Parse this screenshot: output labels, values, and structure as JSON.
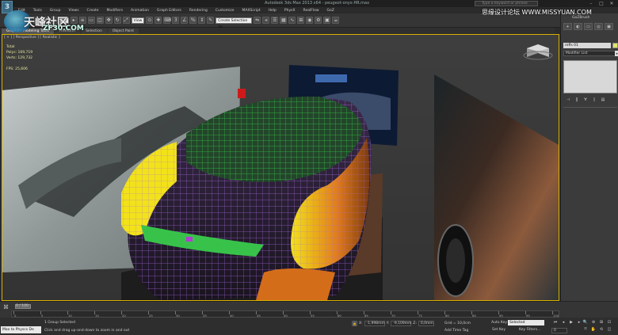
{
  "titlebar": {
    "title": "Autodesk 3ds Max 2013 x64 - peugeot-onyx-HR.max",
    "search_placeholder": "Type a keyword or phrase",
    "minimize": "–",
    "maximize": "□",
    "close": "✕"
  },
  "menu": [
    "Edit",
    "Tools",
    "Group",
    "Views",
    "Create",
    "Modifiers",
    "Animation",
    "Graph Editors",
    "Rendering",
    "Customize",
    "MAXScript",
    "Help",
    "PhysX",
    "RealFlow",
    "GoZ"
  ],
  "toolbar": {
    "selection_filter": "All",
    "view_dropdown": "View",
    "named_selection": "Create Selection Se"
  },
  "ribbon_tabs": [
    {
      "label": "Graphite Modeling Tools",
      "active": true
    },
    {
      "label": "Freeform",
      "active": false
    },
    {
      "label": "Selection",
      "active": false
    },
    {
      "label": "Object Paint",
      "active": false
    }
  ],
  "viewport": {
    "label": "[ + ] [ Perspective ] [ Realistic ]",
    "stats": {
      "total_label": "Total",
      "polys_label": "Polys:",
      "polys_value": "169,719",
      "verts_label": "Verts:",
      "verts_value": "129,732",
      "fps_label": "FPS:",
      "fps_value": "25,606"
    }
  },
  "command_panel": {
    "object_name": "refls 01",
    "modifier_list": "Modifier List",
    "gozbrush": "GoZBrush",
    "tabs": [
      "+",
      "◐",
      "▭",
      "◎",
      "▣",
      "✎"
    ],
    "stack_icons": [
      "⊣",
      "‖",
      "∀",
      "▯",
      "▤"
    ]
  },
  "timeline": {
    "slider_label": "0 / 100",
    "ticks": [
      "0",
      "5",
      "10",
      "15",
      "20",
      "25",
      "30",
      "35",
      "40",
      "45",
      "50",
      "55",
      "60",
      "65",
      "70",
      "75",
      "80",
      "85",
      "90",
      "95",
      "100"
    ]
  },
  "statusbar": {
    "maxscript_text": "Max to Physcs De",
    "selection_status": "1 Group Selected",
    "prompt": "Click and drag up-and-down to zoom in and out",
    "x_label": "X:",
    "x_value": "-1,998mm",
    "y_label": "Y:",
    "y_value": "-9,109mm",
    "z_label": "Z:",
    "z_value": "0,0mm",
    "grid": "Grid = 10,0cm",
    "add_time_tag": "Add Time Tag",
    "auto_key": "Auto Key",
    "set_key": "Set Key",
    "selected_dropdown": "Selected",
    "key_filters": "Key Filters...",
    "frame": "0",
    "play_buttons": [
      "⏮",
      "◂",
      "▶",
      "▸",
      "⏭"
    ],
    "nav_icons": [
      "🔍",
      "⊕",
      "⊞",
      "⊡",
      "⤧",
      "✋",
      "⟲",
      "◫"
    ]
  },
  "watermarks": {
    "left_main": "天峰社区",
    "left_sub": "ZF30.COM",
    "right": "思缘设计论坛 WWW.MISSYUAN.COM"
  },
  "colors": {
    "viewport_border": "#d8b100",
    "wire_green": "#35c24a",
    "wire_purple": "#a86be0",
    "shade_yellow": "#f2e21a",
    "shade_orange": "#e07a1b"
  }
}
